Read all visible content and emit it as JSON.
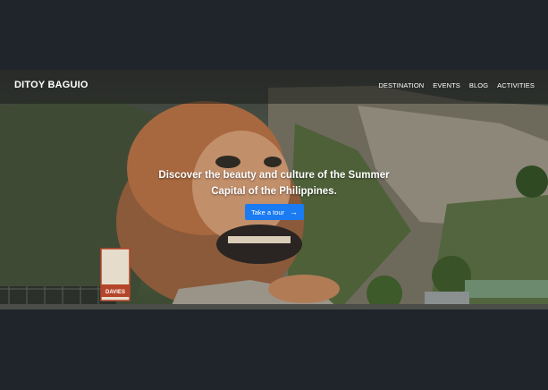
{
  "header": {
    "brand": "DITOY BAGUIO",
    "nav": [
      "DESTINATION",
      "EVENTS",
      "BLOG",
      "ACTIVITIES"
    ]
  },
  "hero": {
    "headline": "Discover the beauty and culture of the Summer Capital of the Philippines.",
    "cta_label": "Take a tour",
    "cta_icon": "arrow-right-icon",
    "signage": "DAVIES"
  },
  "colors": {
    "page_background": "#20242b",
    "accent": "#1a7bf2",
    "text": "#ffffff"
  }
}
